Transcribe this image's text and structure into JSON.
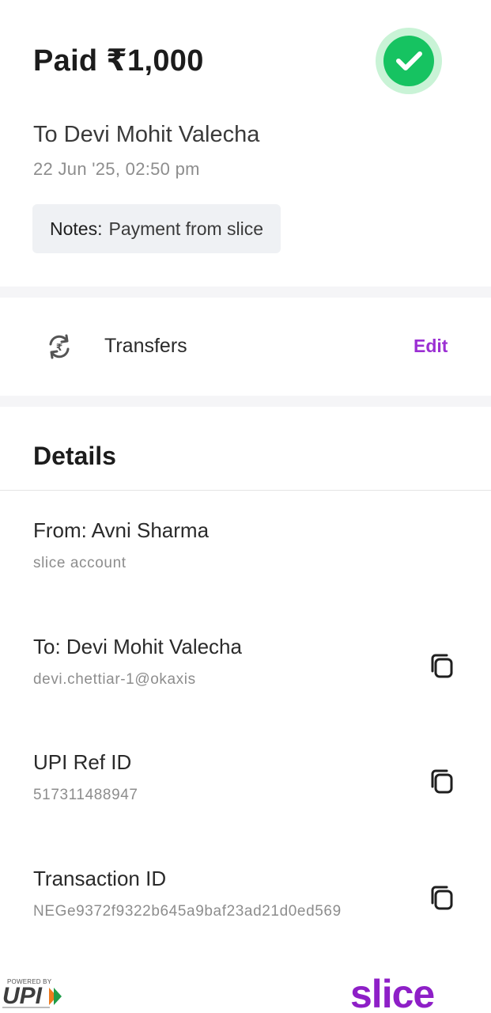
{
  "summary": {
    "status_title": "Paid ₹1,000",
    "payee": "To Devi Mohit Valecha",
    "datetime": "22 Jun '25, 02:50 pm",
    "notes_label": "Notes:",
    "notes_value": "Payment from slice"
  },
  "category": {
    "icon": "rupee-transfer-icon",
    "label": "Transfers",
    "edit_label": "Edit"
  },
  "details": {
    "heading": "Details",
    "from_title": "From: Avni Sharma",
    "from_sub": "slice account",
    "to_title": "To: Devi Mohit Valecha",
    "to_sub": "devi.chettiar-1@okaxis",
    "upi_title": "UPI Ref ID",
    "upi_sub": "517311488947",
    "txn_title": "Transaction ID",
    "txn_sub": "NEGe9372f9322b645a9baf23ad21d0ed569"
  },
  "footer": {
    "upi_powered": "POWERED BY",
    "brand": "slice"
  },
  "colors": {
    "success": "#16c361",
    "accent": "#9b2fd3",
    "brand": "#8e1fc7"
  }
}
